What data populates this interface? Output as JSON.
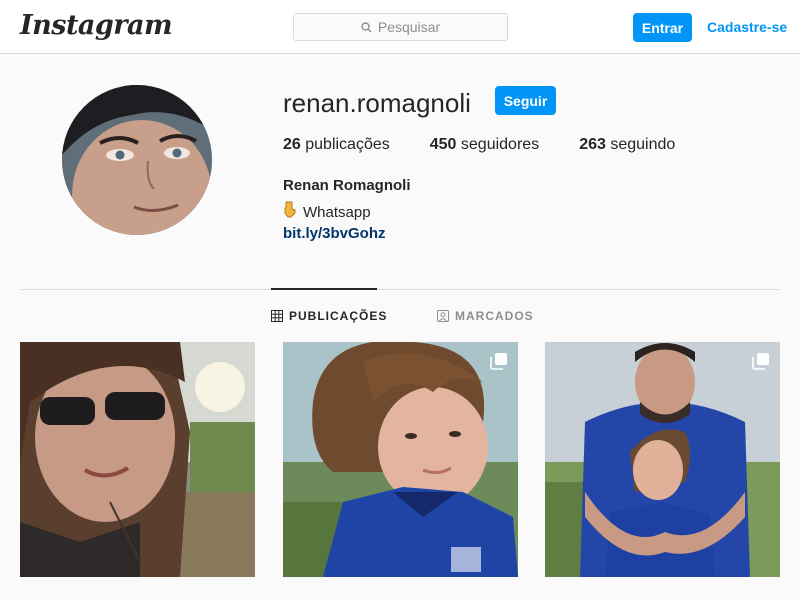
{
  "header": {
    "logo_text": "Instagram",
    "search_placeholder": "Pesquisar",
    "login_label": "Entrar",
    "signup_label": "Cadastre-se"
  },
  "profile": {
    "username": "renan.romagnoli",
    "follow_label": "Seguir",
    "stats": [
      {
        "count": "26",
        "label": "publicações"
      },
      {
        "count": "450",
        "label": "seguidores"
      },
      {
        "count": "263",
        "label": "seguindo"
      }
    ],
    "full_name": "Renan Romagnoli",
    "bio_icon": "hand-pointing-down-icon",
    "bio_text": "Whatsapp",
    "bio_link": "bit.ly/3bvGohz"
  },
  "tabs": {
    "posts_label": "PUBLICAÇÕES",
    "tagged_label": "MARCADOS",
    "active": "posts"
  },
  "posts": [
    {
      "icon": "photo",
      "multiple": false
    },
    {
      "icon": "photo",
      "multiple": true
    },
    {
      "icon": "photo",
      "multiple": true
    }
  ],
  "colors": {
    "accent": "#0095f6",
    "link": "#00376b",
    "text": "#262626",
    "muted": "#8e8e8e",
    "border": "#dbdbdb",
    "background": "#fafafa"
  }
}
